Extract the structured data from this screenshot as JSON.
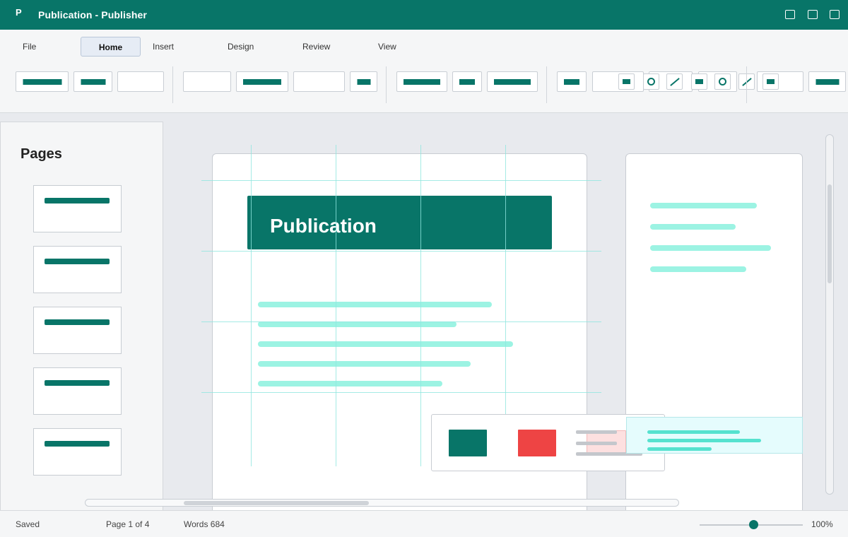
{
  "window": {
    "app_icon_letter": "P",
    "title": "Publication - Publisher"
  },
  "ribbon": {
    "tabs": [
      {
        "label": "File"
      },
      {
        "label": "Home",
        "active": true
      },
      {
        "label": "Insert"
      },
      {
        "label": "Design"
      },
      {
        "label": "Review"
      },
      {
        "label": "View"
      }
    ]
  },
  "pages_pane": {
    "title": "Pages",
    "thumbnail_count": 5
  },
  "document": {
    "title_block_text": "Publication"
  },
  "statusbar": {
    "save_status": "Saved",
    "page_info": "Page 1 of 4",
    "word_count": "Words 684",
    "zoom": "100%"
  },
  "colors": {
    "brand": "#087568",
    "accent_red": "#ee4444",
    "highlight_text": "#9cf3e3"
  },
  "icons": [
    "window-minimize-icon",
    "window-maximize-icon",
    "window-close-icon",
    "circle-shape-icon",
    "line-shape-icon",
    "rectangle-shape-icon"
  ]
}
